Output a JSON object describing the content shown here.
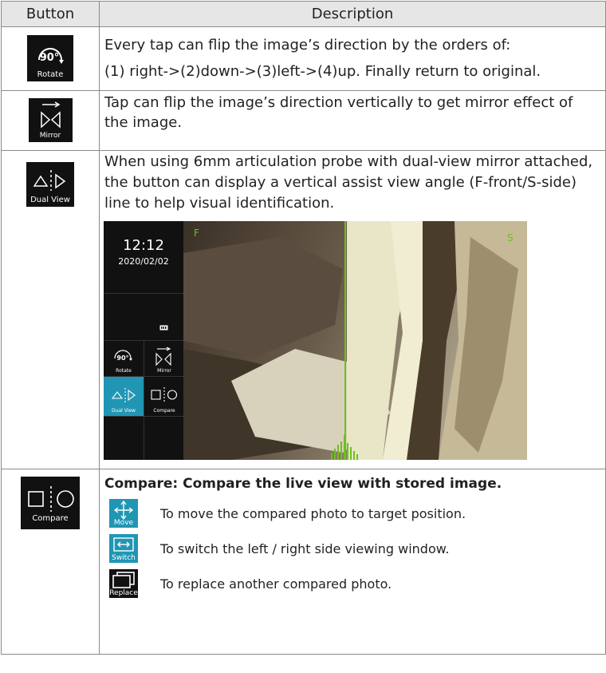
{
  "table": {
    "header_button": "Button",
    "header_description": "Description"
  },
  "rotate": {
    "icon_text": "90°",
    "label": "Rotate",
    "line1": "Every tap can flip the image’s direction by the orders of:",
    "line2": "(1) right->(2)down->(3)left->(4)up. Finally return to original."
  },
  "mirror": {
    "label": "Mirror",
    "line1": "Tap can flip the image’s direction vertically to get mirror effect of",
    "line2": "the image."
  },
  "dual_view": {
    "label": "Dual View",
    "line1": "When using 6mm articulation probe with dual-view mirror attached,",
    "line2": "the button can display a vertical assist view angle (F-front/S-side)",
    "line3": "line to help visual identification.",
    "screenshot": {
      "time": "12:12",
      "date": "2020/02/02",
      "rotate_label": "Rotate",
      "rotate_icon_text": "90°",
      "mirror_label": "Mirror",
      "dual_label": "Dual View",
      "compare_label": "Compare",
      "front_marker": "F",
      "side_marker": "S",
      "accent_color": "#2196b4",
      "guide_color": "#6cc01c"
    }
  },
  "compare": {
    "label": "Compare",
    "title": "Compare: Compare the live view with stored image.",
    "items": [
      {
        "icon": "move-icon",
        "label": "Move",
        "text": "To move the compared photo to target position."
      },
      {
        "icon": "switch-icon",
        "label": "Switch",
        "text": "To switch the left / right side viewing window."
      },
      {
        "icon": "replace-icon",
        "label": "Replace",
        "text": "To replace another compared photo."
      }
    ]
  }
}
